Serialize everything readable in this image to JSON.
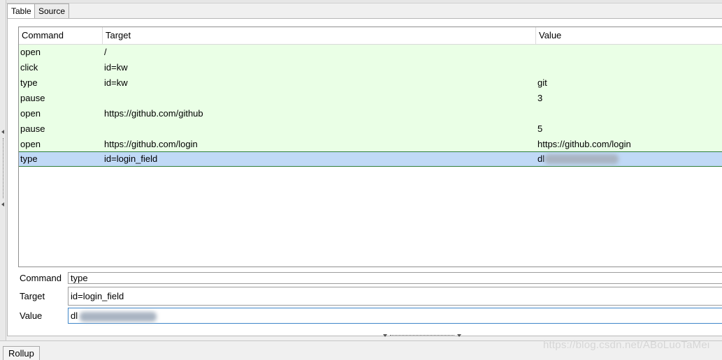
{
  "tabs": [
    {
      "label": "Table",
      "active": true
    },
    {
      "label": "Source",
      "active": false
    }
  ],
  "table": {
    "headers": [
      "Command",
      "Target",
      "Value"
    ],
    "rows": [
      {
        "command": "open",
        "target": "/",
        "value": "",
        "status": "ok"
      },
      {
        "command": "click",
        "target": "id=kw",
        "value": "",
        "status": "ok"
      },
      {
        "command": "type",
        "target": "id=kw",
        "value": "git",
        "status": "ok"
      },
      {
        "command": "pause",
        "target": "",
        "value": "3",
        "status": "ok"
      },
      {
        "command": "open",
        "target": "https://github.com/github",
        "value": "",
        "status": "ok"
      },
      {
        "command": "pause",
        "target": "",
        "value": "5",
        "status": "ok"
      },
      {
        "command": "open",
        "target": "https://github.com/login",
        "value": "https://github.com/login",
        "status": "ok"
      },
      {
        "command": "type",
        "target": "id=login_field",
        "value": "dl",
        "status": "selected"
      }
    ]
  },
  "form": {
    "command_label": "Command",
    "command_value": "type",
    "target_label": "Target",
    "target_value": "id=login_field",
    "value_label": "Value",
    "value_value": "dl"
  },
  "footer": {
    "rollup_label": "Rollup",
    "watermark": "https://blog.csdn.net/ABoLuoTaMei"
  },
  "colors": {
    "passed_row": "#eaffe6",
    "selected_row": "#c0d9f6",
    "selected_border": "#2f7d3a"
  }
}
